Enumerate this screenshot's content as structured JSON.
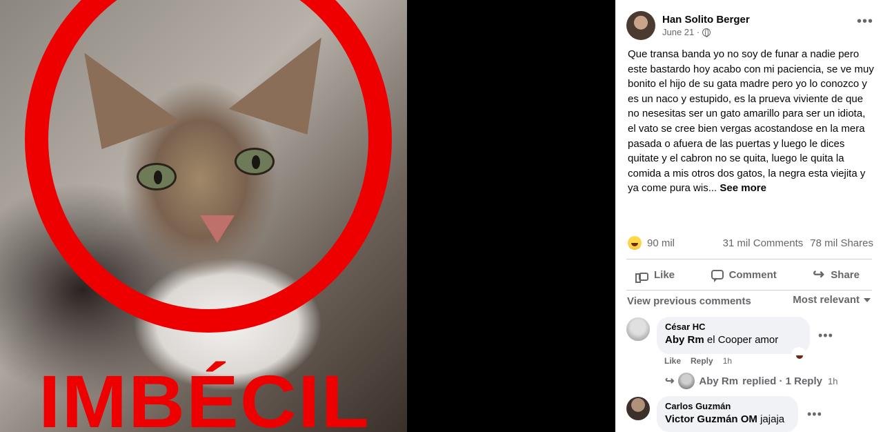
{
  "image": {
    "caption": "IMBÉCIL"
  },
  "post": {
    "author": "Han Solito Berger",
    "date": "June 21 ·",
    "body": "Que transa banda yo no soy de funar a nadie pero este bastardo hoy acabo con mi paciencia, se ve muy bonito el hijo de su gata madre pero yo lo conozco y es un naco y estupido, es la prueva viviente de que no nesesitas ser un gato amarillo para ser un idiota, el vato se cree bien vergas acostandose en la mera pasada o afuera de las puertas y luego le dices quitate y el cabron no se quita, luego le quita la comida a mis otros dos gatos, la negra esta viejita y ya come pura wis...",
    "see_more": "See more",
    "reactions_count": "90 mil",
    "comments_count": "31 mil Comments",
    "shares_count": "78 mil Shares"
  },
  "actions": {
    "like": "Like",
    "comment": "Comment",
    "share": "Share"
  },
  "comments_bar": {
    "view_previous": "View previous comments",
    "sort": "Most relevant"
  },
  "comments": [
    {
      "name": "César HC",
      "tag": "Aby Rm",
      "text": "el Cooper amor",
      "like": "Like",
      "reply": "Reply",
      "time": "1h",
      "reply_summary": {
        "name": "Aby Rm",
        "text": "replied · 1 Reply",
        "time": "1h"
      }
    },
    {
      "name": "Carlos Guzmán",
      "tag": "Victor Guzmán OM",
      "text": "jajaja"
    }
  ],
  "colors": {
    "accent_red": "#ee0000",
    "text_secondary": "#65676b",
    "bubble": "#f0f2f5"
  }
}
